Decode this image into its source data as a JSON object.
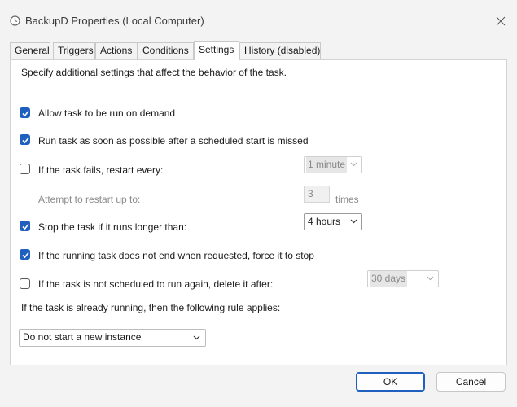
{
  "window": {
    "title": "BackupD Properties (Local Computer)"
  },
  "tabs": [
    {
      "label": "General"
    },
    {
      "label": "Triggers"
    },
    {
      "label": "Actions"
    },
    {
      "label": "Conditions"
    },
    {
      "label": "Settings"
    },
    {
      "label": "History (disabled)"
    }
  ],
  "active_tab": "Settings",
  "settings": {
    "description": "Specify additional settings that affect the behavior of the task.",
    "allow_on_demand": {
      "label": "Allow task to be run on demand",
      "checked": true
    },
    "run_asap": {
      "label": "Run task as soon as possible after a scheduled start is missed",
      "checked": true
    },
    "restart_on_fail": {
      "label": "If the task fails, restart every:",
      "checked": false,
      "interval": "1 minute"
    },
    "restart_attempts": {
      "label": "Attempt to restart up to:",
      "value": "3",
      "unit": "times"
    },
    "stop_if_longer": {
      "label": "Stop the task if it runs longer than:",
      "checked": true,
      "duration": "4 hours"
    },
    "force_stop": {
      "label": "If the running task does not end when requested, force it to stop",
      "checked": true
    },
    "delete_after": {
      "label": "If the task is not scheduled to run again, delete it after:",
      "checked": false,
      "duration": "30 days"
    },
    "running_rule_label": "If the task is already running, then the following rule applies:",
    "running_rule_value": "Do not start a new instance"
  },
  "buttons": {
    "ok": "OK",
    "cancel": "Cancel"
  },
  "colors": {
    "accent": "#1f5fbf",
    "background": "#f3f3f3",
    "panel": "#ffffff"
  }
}
